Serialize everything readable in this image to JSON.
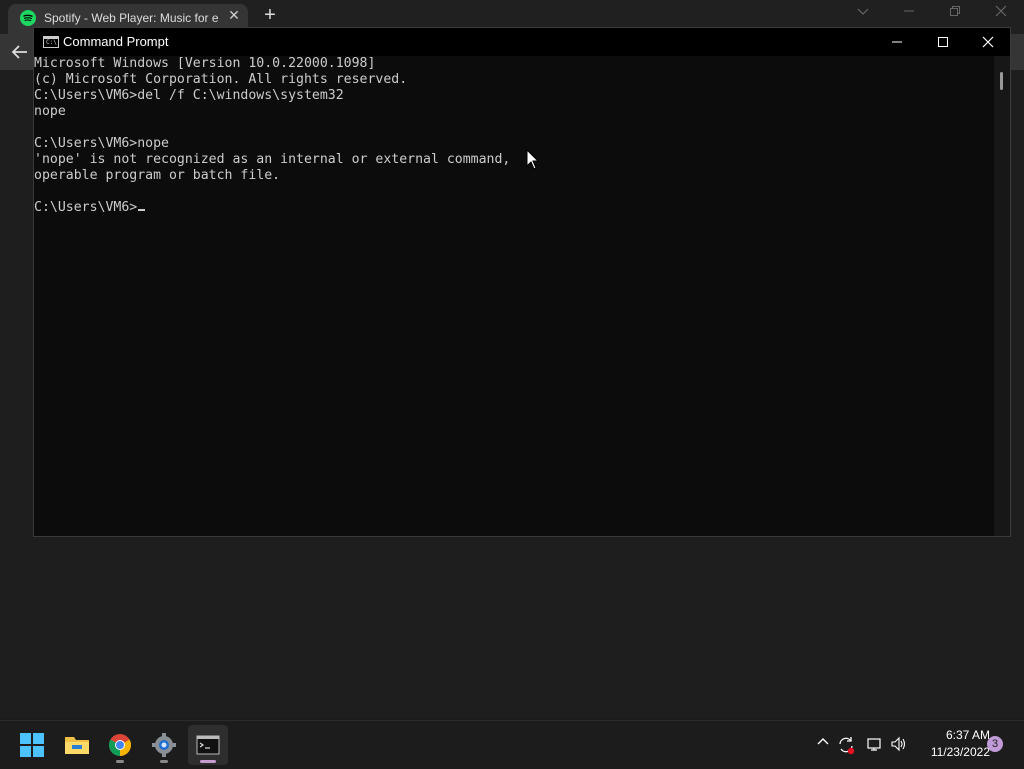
{
  "browser": {
    "tab_title": "Spotify - Web Player: Music for e",
    "tab_close": "✕",
    "new_tab": "+"
  },
  "cmd": {
    "title": "Command Prompt",
    "icon_text": "C:\\",
    "lines": [
      "Microsoft Windows [Version 10.0.22000.1098]",
      "(c) Microsoft Corporation. All rights reserved.",
      "C:\\Users\\VM6>del /f C:\\windows\\system32",
      "nope",
      "",
      "C:\\Users\\VM6>nope",
      "'nope' is not recognized as an internal or external command,",
      "operable program or batch file.",
      "",
      "C:\\Users\\VM6>"
    ]
  },
  "taskbar": {
    "time": "6:37 AM",
    "date": "11/23/2022",
    "notification_count": "3",
    "apps": [
      "start-icon",
      "file-explorer-icon",
      "chrome-icon",
      "settings-icon",
      "command-prompt-icon"
    ]
  },
  "colors": {
    "console_bg": "#0c0c0c",
    "console_text": "#cccccc",
    "spotify_green": "#1ed760",
    "taskbar_bg": "#1c1c1c",
    "active_indicator": "#c89bd0"
  }
}
